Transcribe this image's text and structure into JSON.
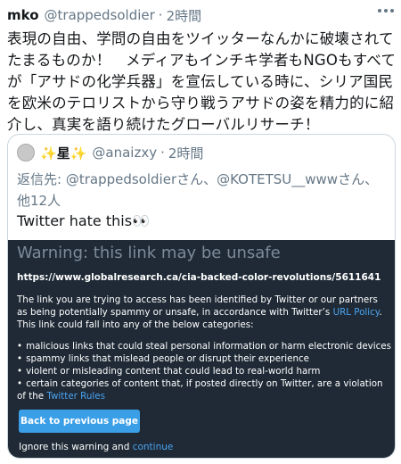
{
  "tweet": {
    "author_name": "mko",
    "author_handle": "@trappedsoldier",
    "separator": "·",
    "time": "2時間",
    "text": "表現の自由、学問の自由をツイッターなんかに破壊されてたまるものか！　メディアもインチキ学者もNGOもすべてが「アサドの化学兵器」を宣伝している時に、シリア国民を欧米のテロリストから守り戦うアサドの姿を精力的に紹介し、真実を語り続けたグローバルリサーチ！"
  },
  "quote": {
    "name_sparkle_left": "✨",
    "name": "星",
    "name_sparkle_right": "✨",
    "handle": "@anaizxy",
    "separator": "·",
    "time": "2時間",
    "reply_prefix": "返信先: ",
    "reply_handle_1": "@trappedsoldier",
    "reply_middle": "さん、",
    "reply_handle_2": "@KOTETSU__www",
    "reply_suffix": "さん、他12人",
    "text": "Twitter hate this👀"
  },
  "warning": {
    "title": "Warning: this link may be unsafe",
    "url": "https://www.globalresearch.ca/cia-backed-color-revolutions/5611641",
    "body_before_link": "The link you are trying to access has been identified by Twitter or our partners as being potentially spammy or unsafe, in accordance with Twitter’s ",
    "policy_link": "URL Policy",
    "body_after_link": ". This link could fall into any of the below categories:",
    "bullets": [
      "malicious links that could steal personal information or harm electronic devices",
      "spammy links that mislead people or disrupt their experience",
      "violent or misleading content that could lead to real-world harm"
    ],
    "last_bullet_text": "certain categories of content that, if posted directly on Twitter, are a violation of the ",
    "rules_link": "Twitter Rules",
    "back_button": "Back to previous page",
    "ignore_text": "Ignore this warning and ",
    "continue_link": "continue"
  },
  "colors": {
    "warning_background": "#1f2a36",
    "link_blue": "#4aa3f0",
    "button_blue": "#3b9fe8",
    "muted_text": "#657786"
  },
  "icons": {
    "more": "more-horizontal-icon",
    "avatar": "avatar"
  }
}
